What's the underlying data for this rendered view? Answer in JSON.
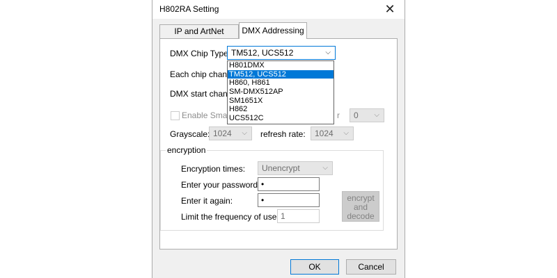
{
  "window": {
    "title": "H802RA Setting",
    "close_glyph": "✕"
  },
  "tabs": [
    {
      "label": "IP and ArtNet settings",
      "active": false
    },
    {
      "label": "DMX Addressing",
      "active": true
    }
  ],
  "dmx": {
    "chip_type_label": "DMX Chip Type:",
    "chip_type_value": "TM512, UCS512",
    "chip_options": [
      "H801DMX",
      "TM512, UCS512",
      "H860, H861",
      "SM-DMX512AP",
      "SM1651X",
      "H862",
      "UCS512C"
    ],
    "each_chip_label": "Each chip channe",
    "start_channel_label": "DMX start channe",
    "enable_smart_label": "Enable Smart",
    "partial_label_r": "r",
    "right_combo_value": "0",
    "grayscale_label": "Grayscale:",
    "grayscale_value": "1024",
    "refresh_label": "refresh rate:",
    "refresh_value": "1024"
  },
  "encryption": {
    "group_title": "encryption",
    "times_label": "Encryption times:",
    "times_value": "Unencrypt",
    "password_label": "Enter your password:",
    "password_value": "•",
    "again_label": "Enter it again:",
    "again_value": "•",
    "limit_label": "Limit the frequency of use:",
    "limit_value": "1",
    "encrypt_button": "encrypt and decode"
  },
  "buttons": {
    "ok": "OK",
    "cancel": "Cancel"
  },
  "icons": {
    "dropdown_arrow": "chevron-down-icon",
    "close": "close-icon"
  },
  "colors": {
    "accent": "#0078d7",
    "selection": "#0078d7"
  }
}
